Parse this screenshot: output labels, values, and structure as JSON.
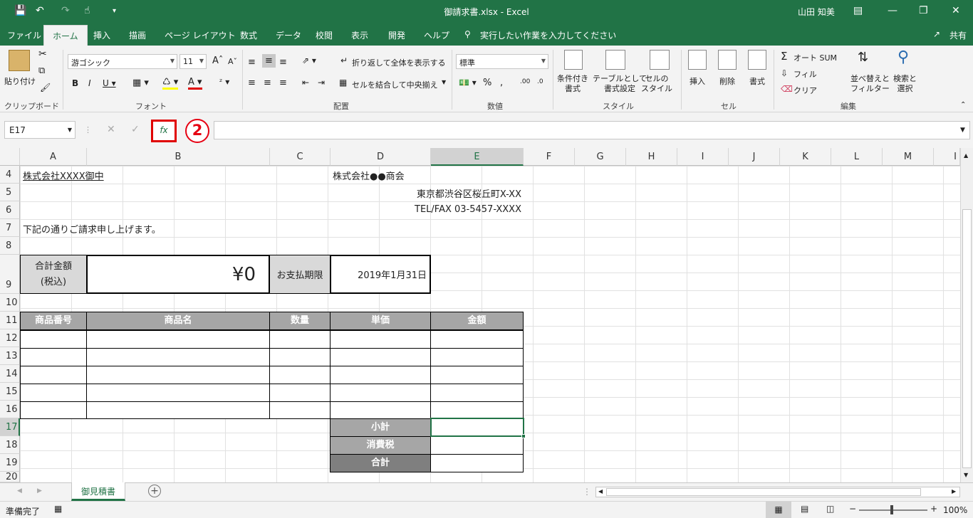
{
  "titlebar": {
    "title": "御請求書.xlsx  -  Excel",
    "user": "山田 知美"
  },
  "tabs": [
    "ファイル",
    "ホーム",
    "挿入",
    "描画",
    "ページ レイアウト",
    "数式",
    "データ",
    "校閲",
    "表示",
    "開発",
    "ヘルプ"
  ],
  "tell_me": "実行したい作業を入力してください",
  "share": "共有",
  "ribbon": {
    "clipboard": {
      "paste": "貼り付け",
      "label": "クリップボード"
    },
    "font": {
      "name": "游ゴシック",
      "size": "11",
      "label": "フォント"
    },
    "alignment": {
      "wrap": "折り返して全体を表示する",
      "merge": "セルを結合して中央揃え",
      "label": "配置"
    },
    "number": {
      "format": "標準",
      "label": "数値"
    },
    "styles": {
      "conditional": "条件付き\n書式",
      "table": "テーブルとして\n書式設定",
      "cell": "セルの\nスタイル",
      "label": "スタイル"
    },
    "cells": {
      "insert": "挿入",
      "delete": "削除",
      "format": "書式",
      "label": "セル"
    },
    "editing": {
      "autosum": "オート SUM",
      "fill": "フィル",
      "clear": "クリア",
      "sort": "並べ替えと\nフィルター",
      "find": "検索と\n選択",
      "label": "編集"
    }
  },
  "formula_bar": {
    "name_box": "E17",
    "fx": "fx",
    "annotation": "2"
  },
  "columns": [
    "A",
    "B",
    "C",
    "D",
    "E",
    "F",
    "G",
    "H",
    "I",
    "J",
    "K",
    "L",
    "M",
    "I"
  ],
  "rows": [
    "4",
    "5",
    "6",
    "7",
    "8",
    "9",
    "10",
    "11",
    "12",
    "13",
    "14",
    "15",
    "16",
    "17",
    "18",
    "19",
    "20"
  ],
  "sheet": {
    "a4": "株式会社XXXX御中",
    "d4": "株式会社●●商会",
    "d5": "東京都渋谷区桜丘町X-XX",
    "d6": "TEL/FAX 03-5457-XXXX",
    "a7": "下記の通りご請求申し上げます。",
    "total_label_1": "合計金額",
    "total_label_2": "(税込)",
    "total_value": "¥0",
    "due_label": "お支払期限",
    "due_date": "2019年1月31日",
    "table_headers": [
      "商品番号",
      "商品名",
      "数量",
      "単価",
      "金額"
    ],
    "subtotal": "小計",
    "tax": "消費税",
    "total": "合計"
  },
  "sheet_tab": "御見積書",
  "status": {
    "ready": "準備完了",
    "zoom": "100%"
  }
}
